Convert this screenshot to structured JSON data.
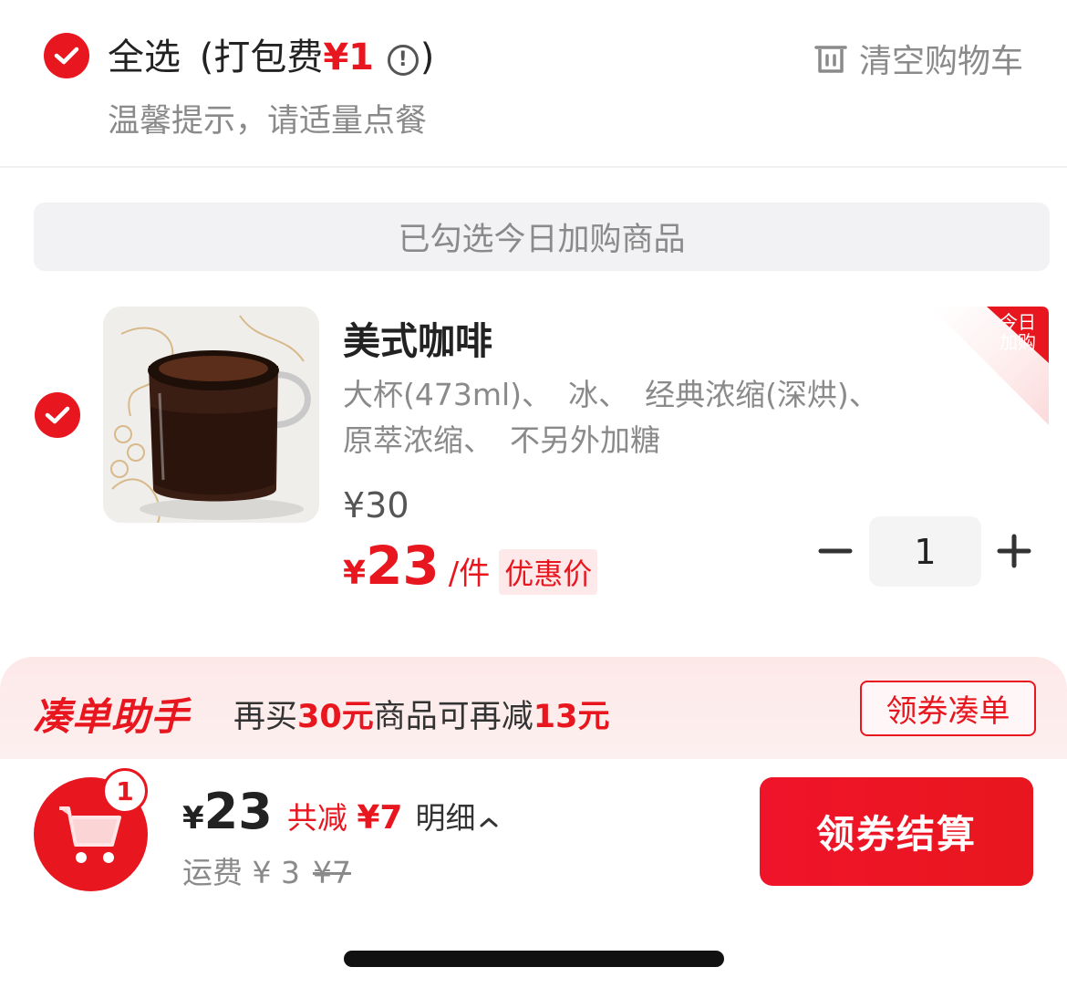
{
  "header": {
    "select_all": "全选",
    "fee_open": "(打包费",
    "fee_price": "¥1",
    "fee_close": ")",
    "info_icon": "info-circle-icon",
    "clear_cart": "清空购物车",
    "tip": "温馨提示，请适量点餐"
  },
  "banner": {
    "text": "已勾选今日加购商品"
  },
  "product": {
    "name": "美式咖啡",
    "options": [
      "大杯(473ml)、",
      "冰、",
      "经典浓缩(深烘)、",
      "原萃浓缩、",
      "不另外加糖"
    ],
    "original_price": "¥30",
    "deal_yen": "¥",
    "deal_price": "23",
    "unit": "/件",
    "deal_tag": "优惠价",
    "badge_line1": "今日",
    "badge_line2": "加购",
    "quantity": "1"
  },
  "helper": {
    "title": "凑单助手",
    "text_part1": "再买",
    "amount": "30元",
    "text_part2": "商品可再减",
    "discount": "13元",
    "button": "领券凑单"
  },
  "footer": {
    "cart_count": "1",
    "total_yen": "¥",
    "total": "23",
    "saved_label": "共减",
    "saved_amount": "¥7",
    "detail": "明细",
    "delivery_label": "运费 ¥ 3",
    "delivery_original": "¥7",
    "checkout": "领券结算"
  },
  "colors": {
    "accent": "#e8161e",
    "muted_text": "#8a8a8a",
    "helper_bg": "#fde8e8"
  }
}
